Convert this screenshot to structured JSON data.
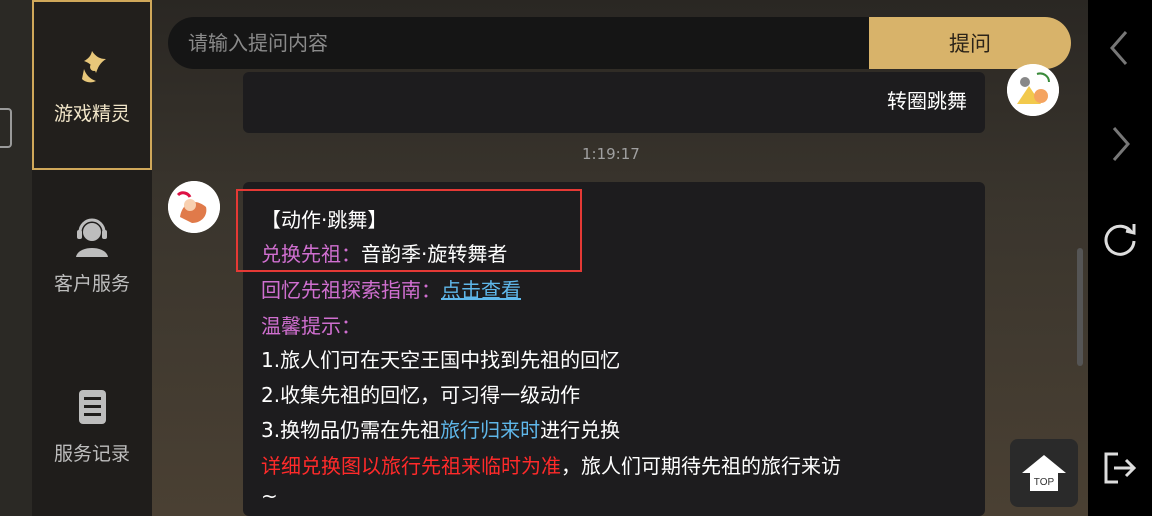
{
  "sidebar": {
    "items": [
      {
        "label": "游戏精灵",
        "icon": "fairy-icon",
        "active": true
      },
      {
        "label": "客户服务",
        "icon": "headset-agent-icon",
        "active": false
      },
      {
        "label": "服务记录",
        "icon": "record-list-icon",
        "active": false
      }
    ]
  },
  "search": {
    "placeholder": "请输入提问内容",
    "button_label": "提问"
  },
  "chat": {
    "user_message": "转圈跳舞",
    "timestamp": "1:19:17",
    "reply": {
      "title": "【动作·跳舞】",
      "exchange_label": "兑换先祖：",
      "exchange_value": "音韵季·旋转舞者",
      "guide_label": "回忆先祖探索指南：",
      "guide_link": "点击查看",
      "tips_label": "温馨提示：",
      "tip1": "1.旅人们可在天空王国中找到先祖的回忆",
      "tip2": "2.收集先祖的回忆，可习得一级动作",
      "tip3_prefix": "3.换物品仍需在先祖",
      "tip3_highlight": "旅行归来时",
      "tip3_suffix": "进行兑换",
      "note_red": "详细兑换图以旅行先祖来临时为准",
      "note_rest": "，旅人们可期待先祖的旅行来访",
      "note_tail": "~"
    }
  },
  "top_button": {
    "label": "TOP"
  },
  "colors": {
    "accent": "#d8b36a",
    "highlight_border": "#e53935",
    "pink": "#d06fd0",
    "link": "#5fb7ea",
    "red": "#ff2a2a"
  }
}
